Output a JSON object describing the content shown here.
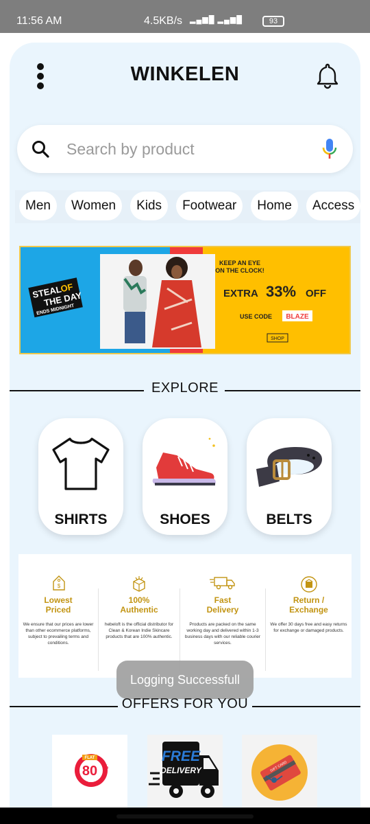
{
  "status_bar": {
    "time": "11:56 AM",
    "network": "4.5KB/s",
    "battery": "93"
  },
  "header": {
    "title": "WINKELEN",
    "menu_icon": "kebab-menu-icon",
    "notification_icon": "bell-icon"
  },
  "search": {
    "placeholder": "Search by product",
    "icon": "search-icon",
    "voice_icon": "mic-icon"
  },
  "categories_chips": [
    "Men",
    "Women",
    "Kids",
    "Footwear",
    "Home",
    "Access"
  ],
  "banner": {
    "steal_of": "STEAL",
    "steal_of2": "OF",
    "the_day": "THE DAY",
    "ends": "ENDS MIDNIGHT",
    "keep_eye": "KEEP AN EYE",
    "on_clock": "ON THE CLOCK!",
    "extra_prefix": "EXTRA",
    "extra_value": "33%",
    "extra_suffix": "OFF",
    "use_code": "USE CODE",
    "code": "BLAZE",
    "shop": "SHOP"
  },
  "explore": {
    "heading": "EXPLORE",
    "items": [
      {
        "label": "SHIRTS",
        "icon": "shirt-icon"
      },
      {
        "label": "SHOES",
        "icon": "shoe-icon"
      },
      {
        "label": "BELTS",
        "icon": "belt-icon"
      }
    ]
  },
  "features": [
    {
      "title1": "Lowest",
      "title2": "Priced",
      "desc": "We ensure that our prices are lower than other ecommerce platforms, subject to prevailing terms and conditions.",
      "icon": "price-tag-icon"
    },
    {
      "title1": "100%",
      "title2": "Authentic",
      "desc": "hebeloft is the official distributor for Clean & Korean Indie Skincare products that are 100% authentic.",
      "icon": "authentic-box-icon"
    },
    {
      "title1": "Fast",
      "title2": "Delivery",
      "desc": "Products are packed on the same working day and delivered within 1-3 business days with our reliable courier services.",
      "icon": "delivery-truck-icon"
    },
    {
      "title1": "Return /",
      "title2": "Exchange",
      "desc": "We offer 30 days free and easy returns for exchange or damaged products.",
      "icon": "return-box-icon"
    }
  ],
  "toast": "Logging Successfull",
  "offers": {
    "heading": "OFFERS FOR YOU",
    "flat": "FLAT",
    "percent": "80",
    "off": "OFF",
    "free": "FREE",
    "delivery": "DELIVERY",
    "gift_card": "GIFT CARD"
  },
  "colors": {
    "app_bg": "#eaf5fd",
    "accent_gold": "#c29412",
    "banner_blue": "#1da6e6",
    "banner_yellow": "#ffbf00",
    "banner_red": "#ef3b3b"
  }
}
